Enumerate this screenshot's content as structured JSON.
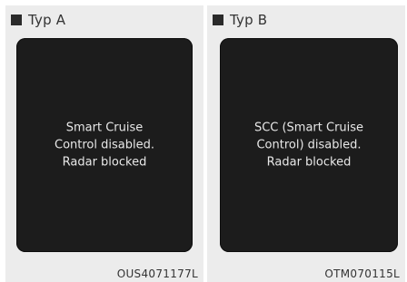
{
  "panels": [
    {
      "title": "Typ A",
      "message": "Smart Cruise\nControl disabled.\nRadar blocked",
      "caption": "OUS4071177L"
    },
    {
      "title": "Typ B",
      "message": "SCC (Smart Cruise\nControl) disabled.\nRadar blocked",
      "caption": "OTM070115L"
    }
  ]
}
